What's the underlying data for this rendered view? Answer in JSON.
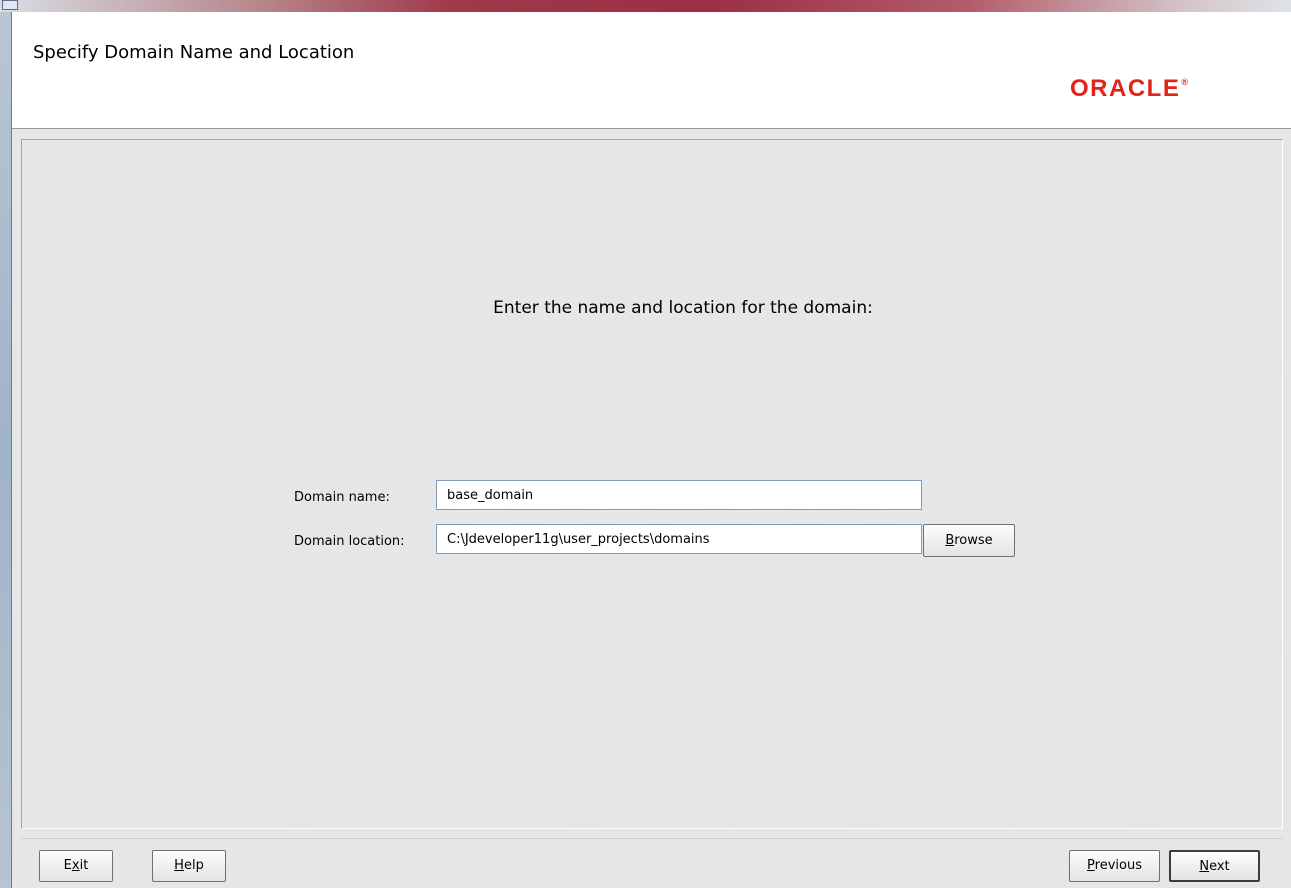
{
  "window": {
    "header_title": "Specify Domain Name and Location",
    "logo_text": "ORACLE",
    "logo_mark": "®",
    "brand_color": "#e2231a"
  },
  "main": {
    "instruction": "Enter the name and location for the domain:",
    "domain_name": {
      "label": "Domain name:",
      "value": "base_domain"
    },
    "domain_location": {
      "label": "Domain location:",
      "value": "C:\\Jdeveloper11g\\user_projects\\domains"
    },
    "browse_button": {
      "mnemonic": "B",
      "rest": "rowse"
    }
  },
  "footer": {
    "exit": {
      "pre": "E",
      "mnemonic": "x",
      "rest": "it"
    },
    "help": {
      "pre": "",
      "mnemonic": "H",
      "rest": "elp"
    },
    "previous": {
      "pre": "",
      "mnemonic": "P",
      "rest": "revious"
    },
    "next": {
      "pre": "",
      "mnemonic": "N",
      "rest": "ext"
    }
  }
}
